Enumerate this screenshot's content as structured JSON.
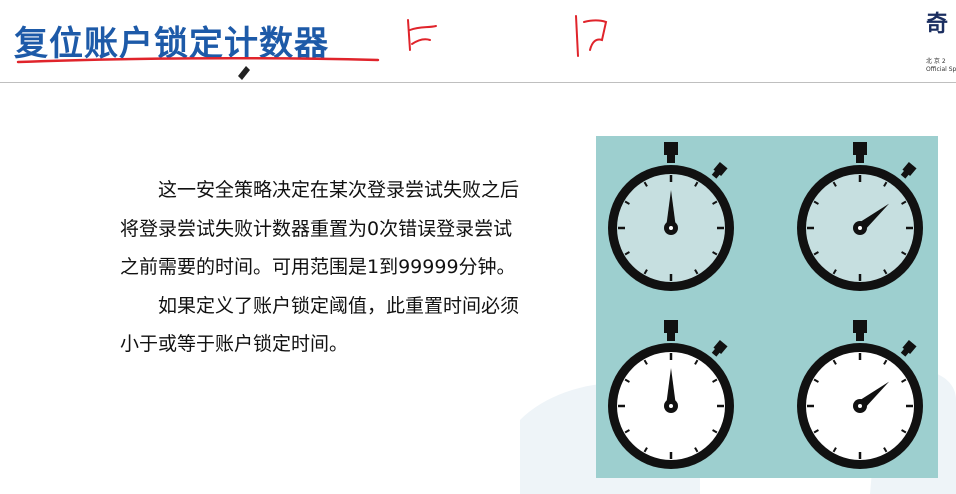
{
  "slide": {
    "title": "复位账户锁定计数器",
    "paragraphs": [
      "这一安全策略决定在某次登录尝试失败之后将登录尝试失败计数器重置为0次错误登录尝试之前需要的时间。可用范围是1到99999分钟。",
      "如果定义了账户锁定阈值，此重置时间必须小于或等于账户锁定时间。"
    ]
  },
  "logo": {
    "char": "奇",
    "line1": "北 京 2",
    "line2": "Official Spo"
  },
  "colors": {
    "title": "#1d5aa8",
    "annotation_red": "#e0242b",
    "panel": "#9dcfcf",
    "watch_dark": "#111111",
    "watch_face_light": "#ffffff",
    "watch_face_dim": "#c6dfe0"
  },
  "illustration": {
    "type": "stopwatch-grid",
    "stopwatches": [
      {
        "name": "stopwatch-top-left",
        "hand": "12 o'clock",
        "face": "tinted"
      },
      {
        "name": "stopwatch-top-right",
        "hand": "2 o'clock",
        "face": "tinted"
      },
      {
        "name": "stopwatch-bottom-left",
        "hand": "12 o'clock",
        "face": "white"
      },
      {
        "name": "stopwatch-bottom-right",
        "hand": "2 o'clock",
        "face": "white"
      }
    ]
  }
}
